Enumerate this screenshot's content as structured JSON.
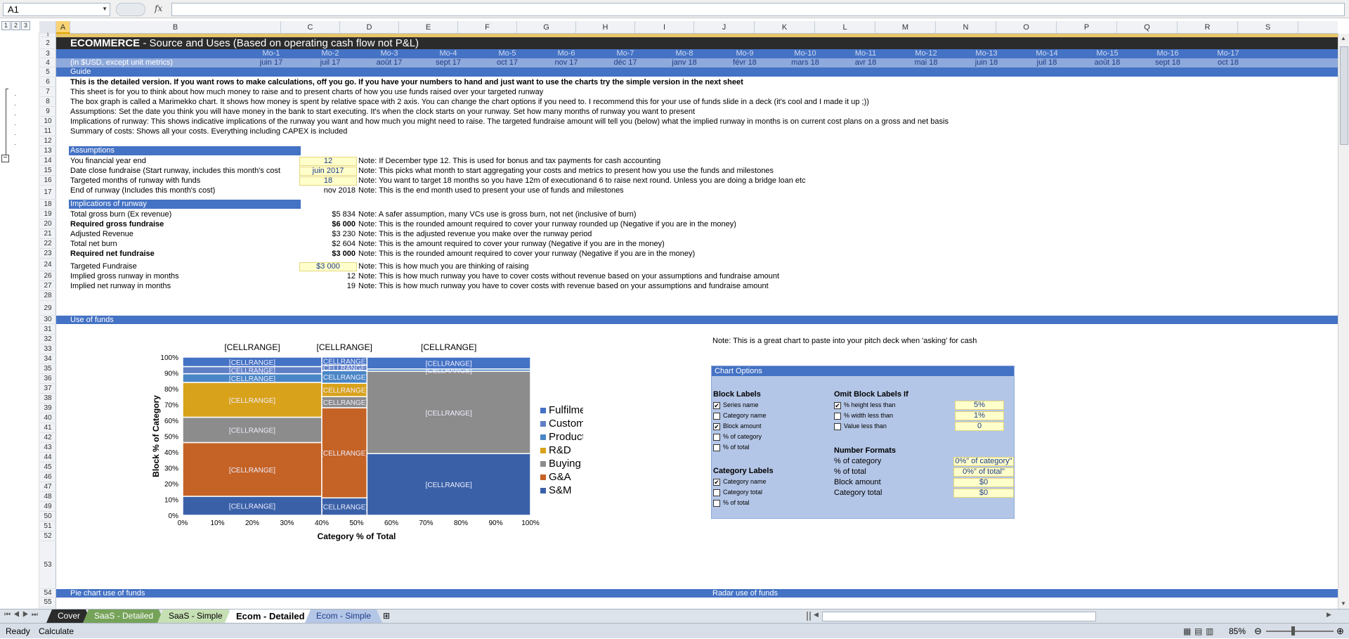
{
  "formula_bar": {
    "name_box": "A1",
    "fx": "fx"
  },
  "outline_levels": [
    "1",
    "2",
    "3"
  ],
  "columns": [
    "A",
    "B",
    "C",
    "D",
    "E",
    "F",
    "G",
    "H",
    "I",
    "J",
    "K",
    "L",
    "M",
    "N",
    "O",
    "P",
    "Q",
    "R",
    "S"
  ],
  "rows": [
    "1",
    "2",
    "3",
    "4",
    "5",
    "6",
    "7",
    "8",
    "9",
    "10",
    "11",
    "12",
    "13",
    "14",
    "15",
    "16",
    "17",
    "18",
    "19",
    "20",
    "21",
    "22",
    "23",
    "24",
    "26",
    "27",
    "28",
    "29",
    "30",
    "31",
    "32",
    "33",
    "34",
    "35",
    "36",
    "37",
    "38",
    "39",
    "40",
    "41",
    "42",
    "43",
    "44",
    "45",
    "46",
    "47",
    "48",
    "49",
    "50",
    "51",
    "52",
    "53",
    "54",
    "55"
  ],
  "title": {
    "bold": "ECOMMERCE",
    "rest": " - Source and Uses (Based on operating cash flow not P&L)"
  },
  "months_row": [
    "Mo-1",
    "Mo-2",
    "Mo-3",
    "Mo-4",
    "Mo-5",
    "Mo-6",
    "Mo-7",
    "Mo-8",
    "Mo-9",
    "Mo-10",
    "Mo-11",
    "Mo-12",
    "Mo-13",
    "Mo-14",
    "Mo-15",
    "Mo-16",
    "Mo-17"
  ],
  "dates_row": [
    "juin 17",
    "juil 17",
    "août 17",
    "sept 17",
    "oct 17",
    "nov 17",
    "déc 17",
    "janv 18",
    "févr 18",
    "mars 18",
    "avr 18",
    "mai 18",
    "juin 18",
    "juil 18",
    "août 18",
    "sept 18",
    "oct 18"
  ],
  "units_label": "(in $USD, except unit metrics)",
  "guide": {
    "header": "Guide",
    "lines": [
      "This is the detailed version. If you want rows to make calculations, off you go. If you have your numbers to hand and just want to use the charts try the simple version in the next sheet",
      "This sheet is for you to think about how much money to raise and to present charts of how you use funds raised over your targeted runway",
      "The box graph is called a Marimekko chart. It shows how money is spent by relative space with 2 axis. You can change the chart options if you need to. I recommend this for your use of funds slide in a deck (it's cool and I made it up ;))",
      "Assumptions: Set the date you think you will have money in the bank to start executing. It's when the clock starts on your runway. Set how many months of runway you want to present",
      "Implications of runway: This shows indicative implications of the runway you want and how much you might need to raise. The targeted fundraise amount will tell you (below) what the implied runway in months is on current cost plans on a gross and net basis",
      "Summary of costs: Shows all your costs. Everything including CAPEX is included"
    ]
  },
  "assumptions": {
    "header": "Assumptions",
    "items": [
      {
        "label": "You financial year end",
        "value": "12",
        "note": "Note: If December type 12. This is used for bonus and tax payments for cash accounting"
      },
      {
        "label": "Date close fundraise (Start runway, includes this month's cost",
        "value": "juin 2017",
        "note": "Note: This picks what month to start aggregating your costs and metrics to present how you use the funds and milestones"
      },
      {
        "label": "Targeted months of runway with funds",
        "value": "18",
        "note": "Note: You want to target 18 months so you have 12m of executionand 6 to raise next round. Unless you are doing a bridge loan etc"
      },
      {
        "label": "End of runway (Includes this month's cost)",
        "value": "nov 2018",
        "note": "Note: This is the end month used to present your use of funds and milestones"
      }
    ]
  },
  "implications": {
    "header": "Implications of runway",
    "items": [
      {
        "label": "Total gross burn (Ex revenue)",
        "value": "$5 834",
        "note": "Note: A safer assumption, many VCs use is gross burn, not net (inclusive of burn)"
      },
      {
        "label": "Required gross fundraise",
        "value": "$6 000",
        "note": "Note: This is the rounded amount required to cover your runway rounded up (Negative if you are in the money)"
      },
      {
        "label": "Adjusted Revenue",
        "value": "$3 230",
        "note": "Note: This is the adjusted revenue you make over the runway period"
      },
      {
        "label": "Total net burn",
        "value": "$2 604",
        "note": "Note: This is the amount required to cover your runway (Negative if you are in the money)"
      },
      {
        "label": "Required net fundraise",
        "value": "$3 000",
        "note": "Note: This is the rounded amount required to cover your runway (Negative if you are in the money)"
      },
      {
        "label": "Targeted Fundraise",
        "value": "$3 000",
        "note": "Note: This is how much you are thinking of raising"
      },
      {
        "label": "Implied gross runway in months",
        "value": "12",
        "note": "Note: This is how much runway you have to cover costs without revenue based on your assumptions and fundraise amount"
      },
      {
        "label": "Implied net runway in months",
        "value": "19",
        "note": "Note: This is how much runway you have to cover costs with revenue based on your assumptions and fundraise amount"
      }
    ]
  },
  "use_of_funds": {
    "header": "Use of funds",
    "note": "Note: This is a great chart to paste into your pitch deck when 'asking' for cash"
  },
  "chart_data": {
    "type": "marimekko",
    "xlabel": "Category % of Total",
    "ylabel": "Block % of Category",
    "x_ticks": [
      "0%",
      "10%",
      "20%",
      "30%",
      "40%",
      "50%",
      "60%",
      "70%",
      "80%",
      "90%",
      "100%"
    ],
    "y_ticks": [
      "0%",
      "10%",
      "20%",
      "30%",
      "40%",
      "50%",
      "60%",
      "70%",
      "80%",
      "90%",
      "100%"
    ],
    "column_label": "[CELLRANGE]",
    "block_label": "[CELLRANGE]",
    "legend": [
      {
        "name": "Fulfilment",
        "color": "#4472c4"
      },
      {
        "name": "Customer Care",
        "color": "#5f7fc5"
      },
      {
        "name": "Production",
        "color": "#4a86c5"
      },
      {
        "name": "R&D",
        "color": "#d9a21b"
      },
      {
        "name": "Buying",
        "color": "#8c8c8c"
      },
      {
        "name": "G&A",
        "color": "#c56326"
      },
      {
        "name": "S&M",
        "color": "#3a61a8"
      }
    ],
    "columns": [
      {
        "width": 40,
        "blocks": [
          {
            "series": "S&M",
            "value": 12
          },
          {
            "series": "G&A",
            "value": 34
          },
          {
            "series": "Buying",
            "value": 16
          },
          {
            "series": "R&D",
            "value": 22
          },
          {
            "series": "Production",
            "value": 5.5
          },
          {
            "series": "Customer Care",
            "value": 4.5
          },
          {
            "series": "Fulfilment",
            "value": 6
          }
        ]
      },
      {
        "width": 13,
        "blocks": [
          {
            "series": "S&M",
            "value": 11
          },
          {
            "series": "G&A",
            "value": 57
          },
          {
            "series": "Buying",
            "value": 7
          },
          {
            "series": "R&D",
            "value": 8.5
          },
          {
            "series": "Production",
            "value": 8
          },
          {
            "series": "Customer Care",
            "value": 3.5
          },
          {
            "series": "Fulfilment",
            "value": 5
          }
        ]
      },
      {
        "width": 47,
        "blocks": [
          {
            "series": "S&M",
            "value": 39
          },
          {
            "series": "Buying",
            "value": 52
          },
          {
            "series": "Production",
            "value": 1.5
          },
          {
            "series": "Fulfilment",
            "value": 7.5
          }
        ]
      }
    ]
  },
  "chart_options": {
    "header": "Chart Options",
    "block_labels": {
      "title": "Block Labels",
      "items": [
        {
          "label": "Series name",
          "checked": true
        },
        {
          "label": "Category name",
          "checked": false
        },
        {
          "label": "Block amount",
          "checked": true
        },
        {
          "label": "% of category",
          "checked": false
        },
        {
          "label": "% of total",
          "checked": false
        }
      ]
    },
    "omit": {
      "title": "Omit Block Labels If",
      "items": [
        {
          "label": "% height less than",
          "checked": true,
          "value": "5%"
        },
        {
          "label": "% width less than",
          "checked": false,
          "value": "1%"
        },
        {
          "label": "Value less than",
          "checked": false,
          "value": "0"
        }
      ]
    },
    "category_labels": {
      "title": "Category Labels",
      "items": [
        {
          "label": "Category name",
          "checked": true
        },
        {
          "label": "Category total",
          "checked": false
        },
        {
          "label": "% of total",
          "checked": false
        }
      ]
    },
    "number_formats": {
      "title": "Number Formats",
      "items": [
        {
          "label": "% of category",
          "value": "0%\" of category\""
        },
        {
          "label": "% of total",
          "value": "0%\" of total\""
        },
        {
          "label": "Block amount",
          "value": "$0"
        },
        {
          "label": "Category total",
          "value": "$0"
        }
      ]
    }
  },
  "bottom_headers": {
    "pie": "Pie chart use of funds",
    "radar": "Radar use of funds"
  },
  "tabs": [
    {
      "label": "Cover",
      "bg": "#2b2b2b",
      "fg": "#ffffff"
    },
    {
      "label": "SaaS - Detailed",
      "bg": "#76a35a",
      "fg": "#ffffff"
    },
    {
      "label": "SaaS - Simple",
      "bg": "#c6e0b4",
      "fg": "#000000"
    },
    {
      "label": "Ecom - Detailed",
      "bg": "#ffffff",
      "fg": "#000000"
    },
    {
      "label": "Ecom - Simple",
      "bg": "#b4c7e7",
      "fg": "#1f3c88"
    }
  ],
  "status": {
    "ready": "Ready",
    "calculate": "Calculate",
    "zoom": "85%"
  }
}
